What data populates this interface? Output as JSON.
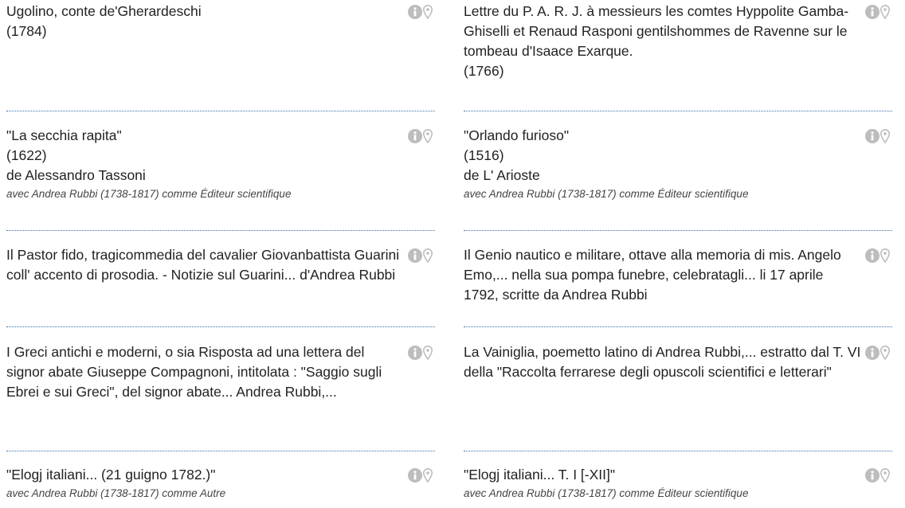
{
  "colors": {
    "icon": "#bdbdbd",
    "divider": "#3a6fb0",
    "text": "#222222",
    "credit": "#444444"
  },
  "icons": [
    "info-icon",
    "map-pin-icon"
  ],
  "records": [
    {
      "lines": [
        "Ugolino, conte de'Gherardeschi",
        "(1784)"
      ],
      "credit": ""
    },
    {
      "lines": [
        "Lettre du P. A. R. J. à messieurs les comtes Hyppolite Gamba-Ghiselli et Renaud Rasponi gentilshommes de Ravenne sur le tombeau d'Isaace Exarque.",
        "(1766)"
      ],
      "credit": ""
    },
    {
      "lines": [
        "\"La secchia rapita\"",
        "(1622)",
        "de Alessandro Tassoni"
      ],
      "credit": "avec Andrea Rubbi (1738-1817) comme Éditeur scientifique"
    },
    {
      "lines": [
        "\"Orlando furioso\"",
        "(1516)",
        "de L' Arioste"
      ],
      "credit": "avec Andrea Rubbi (1738-1817) comme Éditeur scientifique"
    },
    {
      "lines": [
        "Il Pastor fido, tragicommedia del cavalier Giovanbattista Guarini coll' accento di prosodia. - Notizie sul Guarini... d'Andrea Rubbi"
      ],
      "credit": ""
    },
    {
      "lines": [
        "Il Genio nautico e militare, ottave alla memoria di mis. Angelo Emo,... nella sua pompa funebre, celebratagli... li 17 aprile 1792, scritte da Andrea Rubbi"
      ],
      "credit": ""
    },
    {
      "lines": [
        "I Greci antichi e moderni, o sia Risposta ad una lettera del signor abate Giuseppe Compagnoni, intitolata : \"Saggio sugli Ebrei e sui Greci\", del signor abate... Andrea Rubbi,..."
      ],
      "credit": ""
    },
    {
      "lines": [
        "La Vainiglia, poemetto latino di Andrea Rubbi,... estratto dal T. VI della \"Raccolta ferrarese degli opuscoli scientifici e letterari\""
      ],
      "credit": ""
    },
    {
      "lines": [
        "\"Elogj italiani... (21 guigno 1782.)\""
      ],
      "credit": "avec Andrea Rubbi (1738-1817) comme Autre"
    },
    {
      "lines": [
        "\"Elogj italiani... T. I [-XII]\""
      ],
      "credit": "avec Andrea Rubbi (1738-1817) comme Éditeur scientifique"
    }
  ]
}
